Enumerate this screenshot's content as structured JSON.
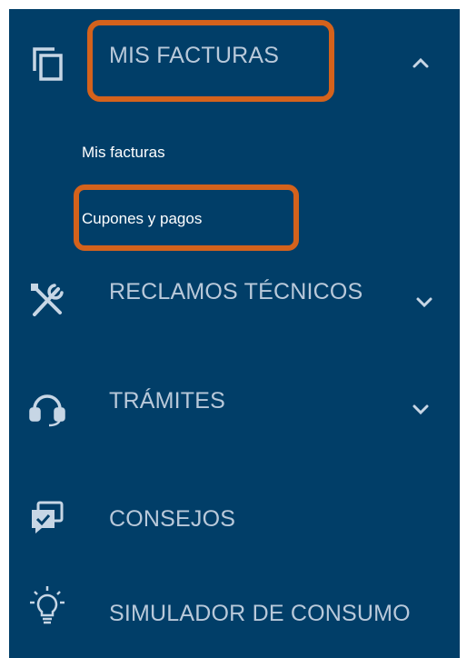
{
  "menu": {
    "facturas": {
      "label": "MIS FACTURAS",
      "icon": "copy-icon",
      "expanded": true,
      "sub_items": [
        {
          "label": "Mis facturas"
        },
        {
          "label": "Cupones y pagos"
        }
      ]
    },
    "reclamos": {
      "label": "RECLAMOS TÉCNICOS",
      "icon": "tools-icon"
    },
    "tramites": {
      "label": "TRÁMITES",
      "icon": "headset-icon"
    },
    "consejos": {
      "label": "CONSEJOS",
      "icon": "chat-check-icon"
    },
    "simulador": {
      "label": "SIMULADOR DE CONSUMO",
      "icon": "lightbulb-icon"
    }
  },
  "colors": {
    "background": "#013e68",
    "label": "#b9c9da",
    "sub_label": "#ffffff",
    "highlight": "#d4621c"
  }
}
